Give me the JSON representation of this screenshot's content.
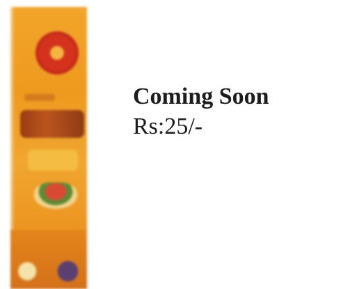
{
  "product": {
    "image_icon": "product-package-image",
    "title": "Coming Soon",
    "price": "Rs:25/-"
  },
  "colors": {
    "package_orange": "#ee9a1f",
    "package_red": "#d4321d",
    "text": "#1c1c1c",
    "background": "#ffffff"
  }
}
